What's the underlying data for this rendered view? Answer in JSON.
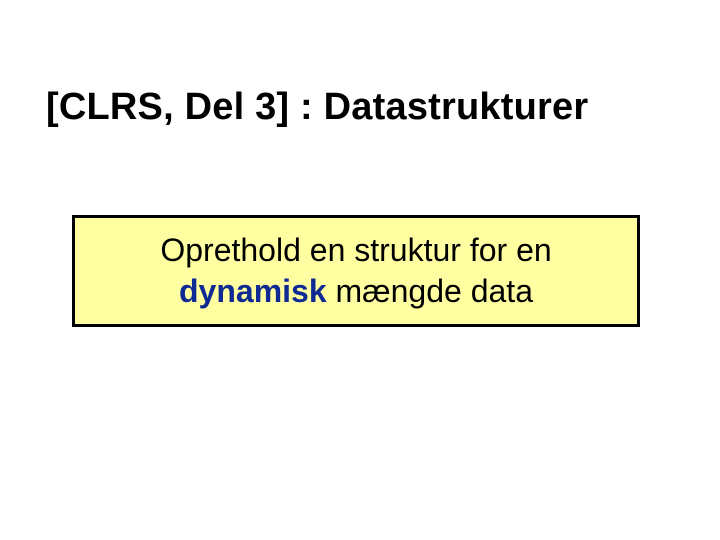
{
  "title": "[CLRS, Del 3] : Datastrukturer",
  "box": {
    "line1": "Oprethold en struktur for en",
    "dynamic": "dynamisk",
    "rest2": " mængde data"
  }
}
